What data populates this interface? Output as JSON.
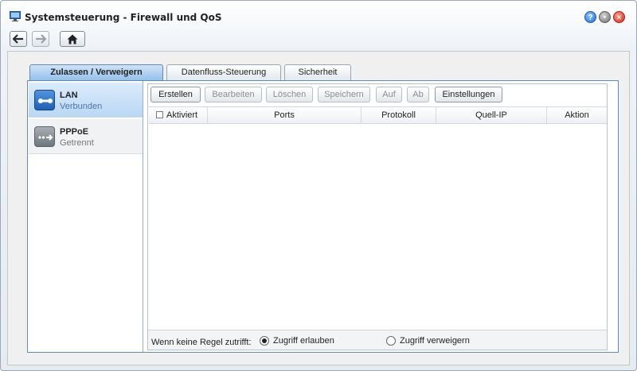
{
  "window": {
    "title": "Systemsteuerung - Firewall und QoS",
    "app_icon": "control-panel-icon",
    "controls": [
      {
        "name": "help",
        "glyph": "?"
      },
      {
        "name": "minimize",
        "glyph": "●"
      },
      {
        "name": "close",
        "glyph": "✕"
      }
    ]
  },
  "nav": {
    "back_icon": "arrow-left-icon",
    "forward_icon": "arrow-right-icon",
    "home_icon": "home-icon"
  },
  "tabs": [
    {
      "label": "Zulassen / Verweigern",
      "active": true
    },
    {
      "label": "Datenfluss-Steuerung",
      "active": false
    },
    {
      "label": "Sicherheit",
      "active": false
    }
  ],
  "sidebar": {
    "items": [
      {
        "name": "LAN",
        "status": "Verbunden",
        "icon": "lan-connected-icon",
        "selected": true
      },
      {
        "name": "PPPoE",
        "status": "Getrennt",
        "icon": "pppoe-disconnected-icon",
        "selected": false
      }
    ]
  },
  "toolbar": {
    "buttons": [
      {
        "label": "Erstellen",
        "enabled": true
      },
      {
        "label": "Bearbeiten",
        "enabled": false
      },
      {
        "label": "Löschen",
        "enabled": false
      },
      {
        "label": "Speichern",
        "enabled": false
      },
      {
        "label": "Auf",
        "enabled": false
      },
      {
        "label": "Ab",
        "enabled": false
      },
      {
        "label": "Einstellungen",
        "enabled": true
      }
    ]
  },
  "table": {
    "columns": [
      "Aktiviert",
      "Ports",
      "Protokoll",
      "Quell-IP",
      "Aktion"
    ],
    "rows": []
  },
  "footer": {
    "label": "Wenn keine Regel zutrifft:",
    "options": [
      {
        "label": "Zugriff erlauben",
        "selected": true
      },
      {
        "label": "Zugriff verweigern",
        "selected": false
      }
    ]
  },
  "colors": {
    "accent": "#5a8cc2",
    "selected_item": "#b9d7f5",
    "close": "#d42a17",
    "help": "#1d6fcf"
  }
}
